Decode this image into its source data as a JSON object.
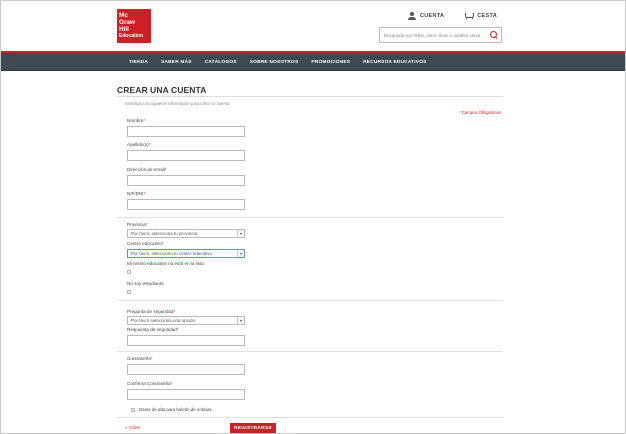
{
  "brand": {
    "logo_lines": [
      "Mc",
      "Graw",
      "Hill",
      "Education"
    ]
  },
  "header": {
    "account_label": "CUENTA",
    "cart_label": "CESTA",
    "search_placeholder": "Busqueda por ISBN, autor, título o palabra clave"
  },
  "nav": {
    "items": [
      "TIENDA",
      "SABER MÁS",
      "CATÁLOGOS",
      "SOBRE NOSOTROS",
      "PROMOCIONES",
      "RECURSOS EDUCATIVOS"
    ]
  },
  "form": {
    "title": "CREAR UNA CUENTA",
    "intro": "Introduzca la siguiente información para crear su cuenta",
    "required_note": "*Campos Obligatorios",
    "nombre_label": "Nombre",
    "apellidos_label": "Apellido(s)",
    "email_label": "Dirección de email",
    "nif_label": "NIF/DNI",
    "provincia_label": "Provincia",
    "provincia_value": "Por favor, selecciona tu provincia",
    "centro_label": "Centro educativo",
    "centro_value": "Por favor, selecciona tu centro educativo",
    "centro_missing_label": "Mi centro educativo no está en la lista",
    "no_estudiante_label": "No soy estudiante",
    "pregunta_label": "Pregunta de seguridad",
    "pregunta_value": "Por favor selecciona una opción",
    "respuesta_label": "Respuesta de seguridad",
    "password_label": "Contraseña",
    "confirm_password_label": "Confirma Contraseña",
    "newsletter_label": "Darse de alta para boletín de noticias",
    "back_label": "« Volver",
    "submit_label": "REGISTRARSE",
    "required_marker": "*"
  },
  "colors": {
    "brand_red": "#d21f26",
    "nav_bg": "#3d4a52"
  }
}
